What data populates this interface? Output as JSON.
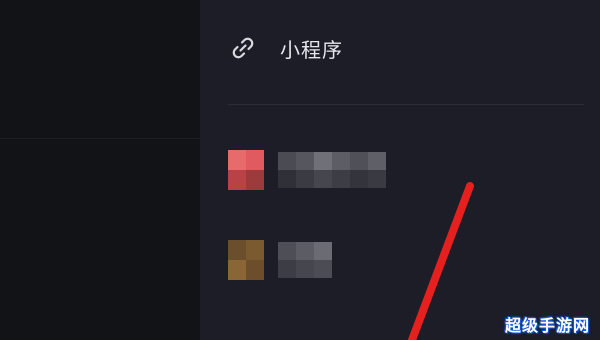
{
  "menu": {
    "title": "小程序",
    "icon": "link-icon"
  },
  "items": [
    {
      "icon": "pixelated-avatar",
      "label_redacted": true,
      "accent": "#e8676a"
    },
    {
      "icon": "pixelated-avatar",
      "label_redacted": true,
      "accent": "#7d5a2e"
    }
  ],
  "colors": {
    "panel_bg": "#1c1d26",
    "left_bg": "#121317",
    "text": "#e6e7ec",
    "annotation_stroke": "#e5201f"
  },
  "watermark": {
    "text": "超级手游网"
  }
}
